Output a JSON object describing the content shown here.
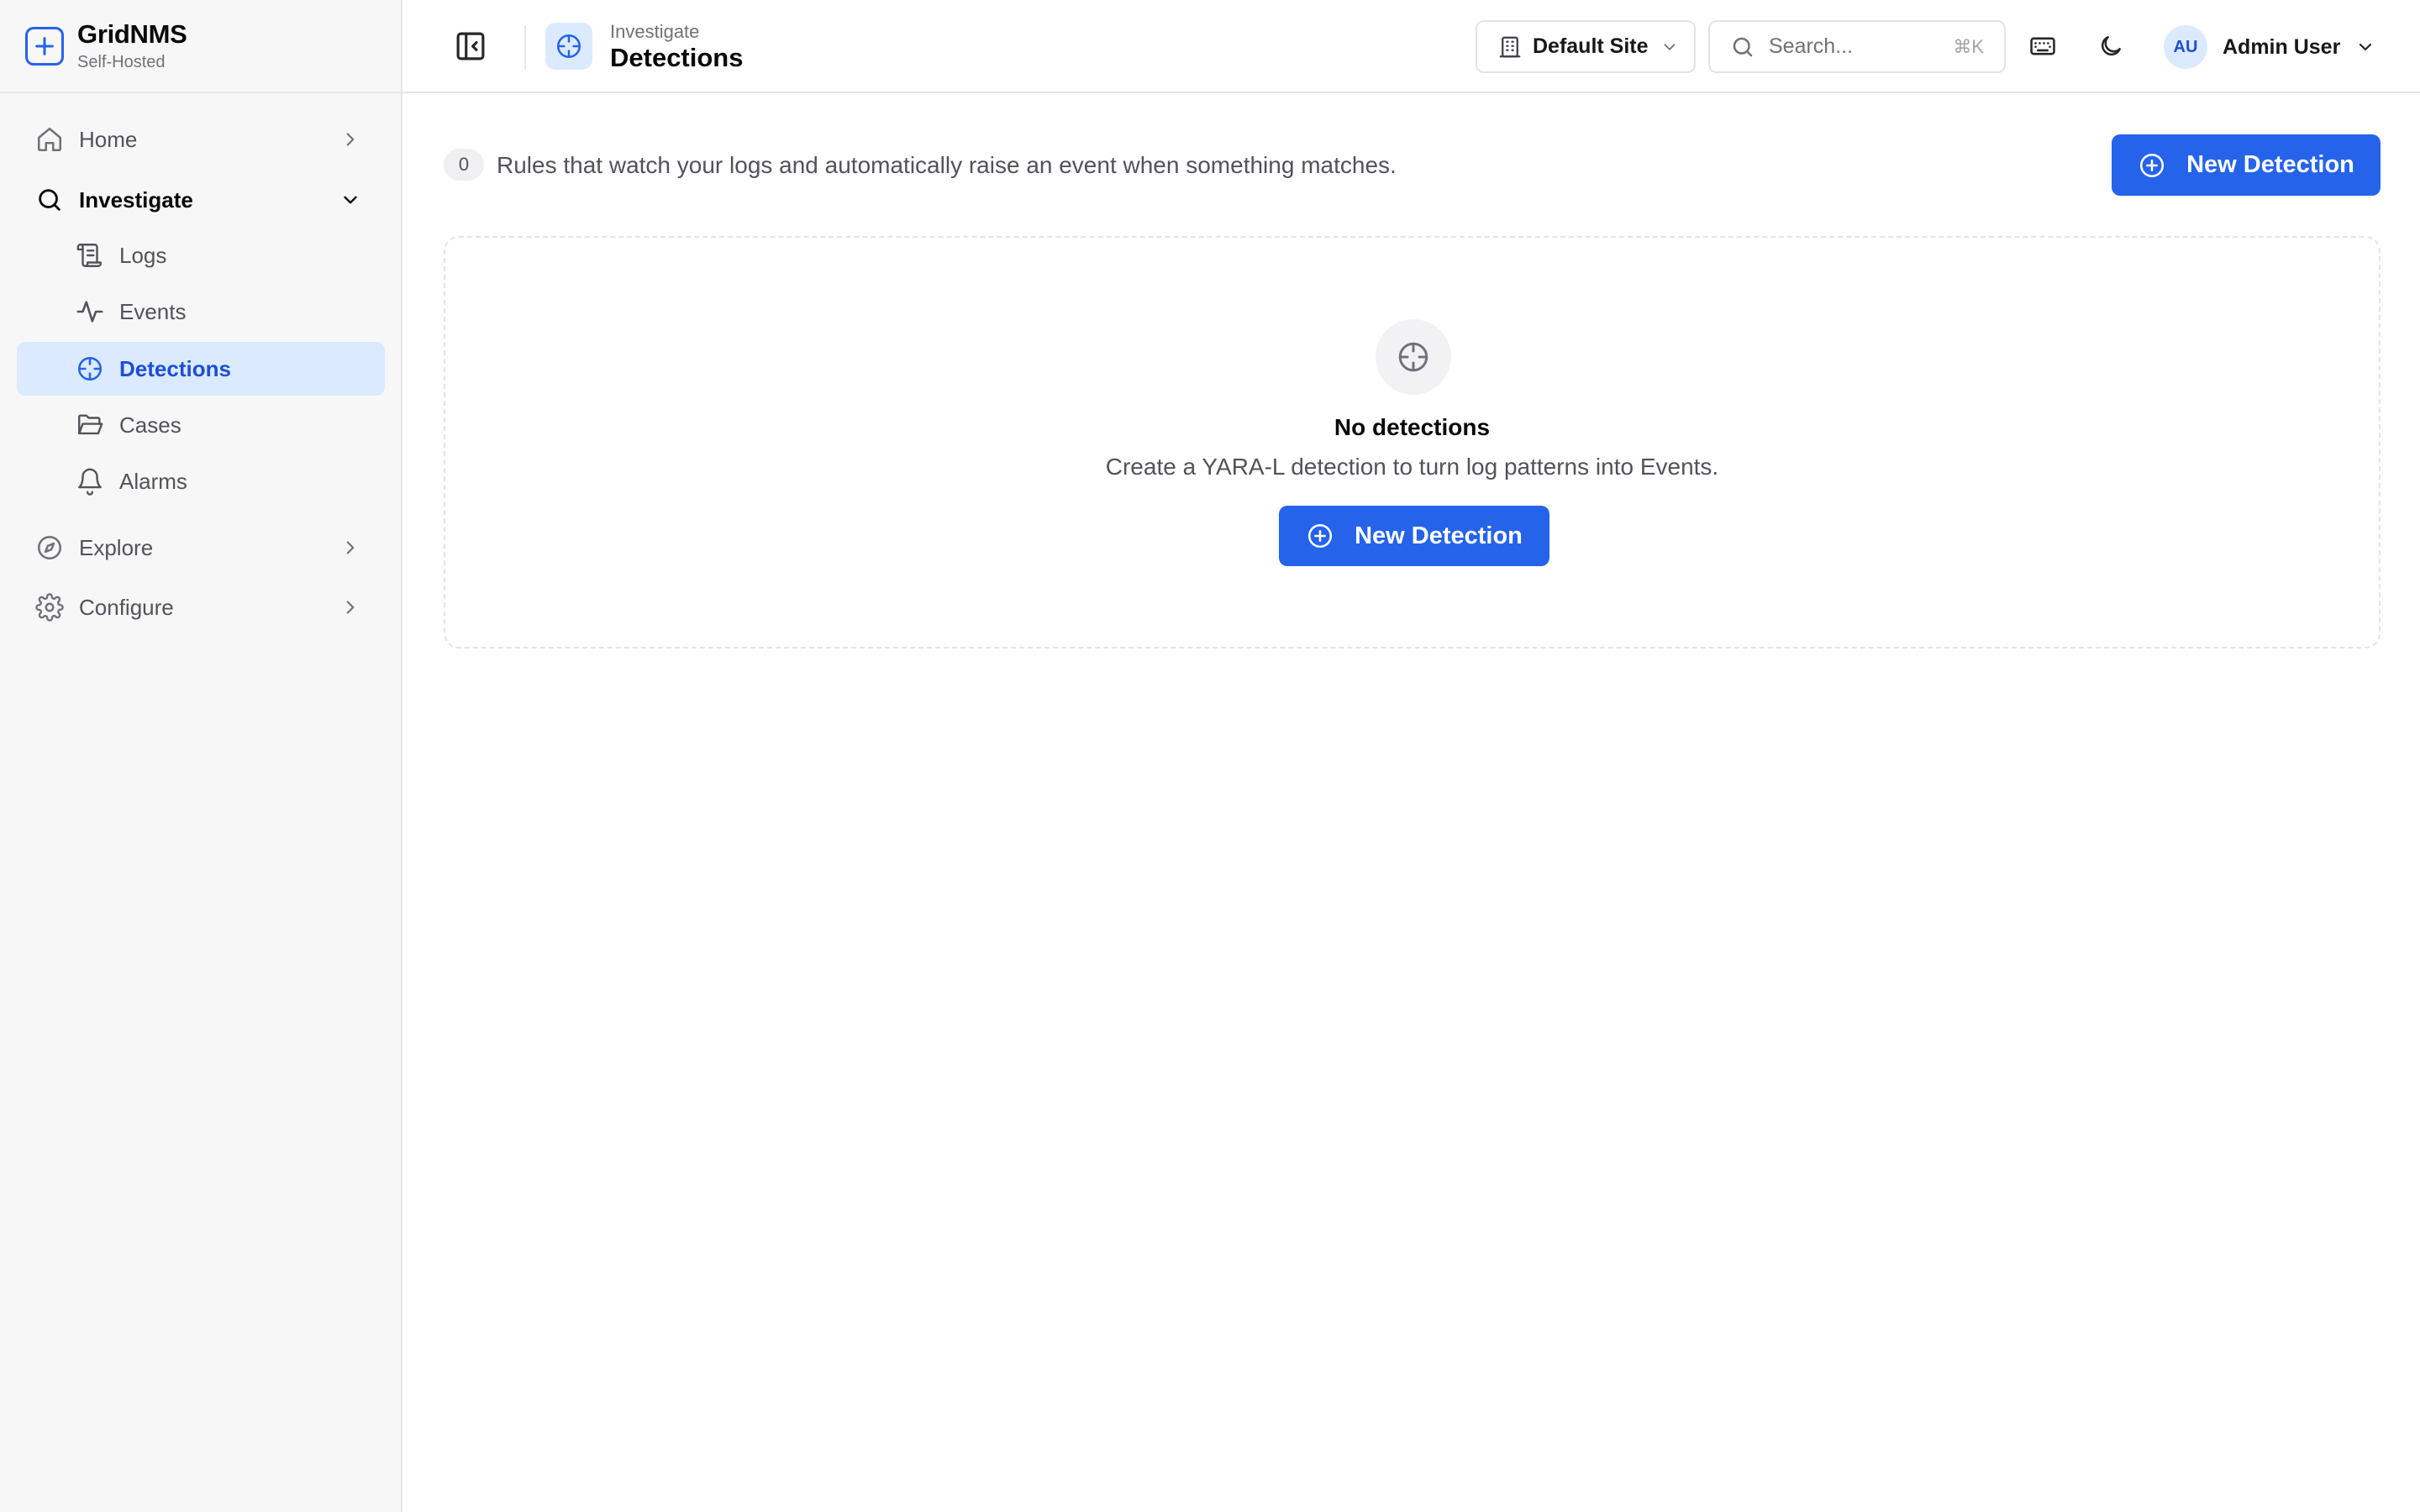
{
  "brand": {
    "name": "GridNMS",
    "subtitle": "Self-Hosted"
  },
  "sidebar": {
    "items": [
      {
        "label": "Home",
        "icon": "home-icon"
      },
      {
        "label": "Investigate",
        "icon": "search-icon",
        "expanded": true,
        "children": [
          {
            "label": "Logs",
            "icon": "scroll-icon"
          },
          {
            "label": "Events",
            "icon": "activity-icon"
          },
          {
            "label": "Detections",
            "icon": "crosshair-icon",
            "active": true
          },
          {
            "label": "Cases",
            "icon": "folder-open-icon"
          },
          {
            "label": "Alarms",
            "icon": "bell-icon"
          }
        ]
      },
      {
        "label": "Explore",
        "icon": "compass-icon"
      },
      {
        "label": "Configure",
        "icon": "gear-icon"
      }
    ]
  },
  "header": {
    "breadcrumb_parent": "Investigate",
    "title": "Detections",
    "site_select": "Default Site",
    "search_placeholder": "Search...",
    "search_shortcut": "⌘K",
    "user": {
      "initials": "AU",
      "name": "Admin User"
    }
  },
  "main": {
    "count": "0",
    "description": "Rules that watch your logs and automatically raise an event when something matches.",
    "new_button_label": "New Detection",
    "empty": {
      "title": "No detections",
      "subtitle": "Create a YARA-L detection to turn log patterns into Events.",
      "button_label": "New Detection"
    }
  },
  "colors": {
    "accent": "#2563eb",
    "active_bg": "#dbeafe",
    "sidebar_bg": "#f7f7f8"
  }
}
